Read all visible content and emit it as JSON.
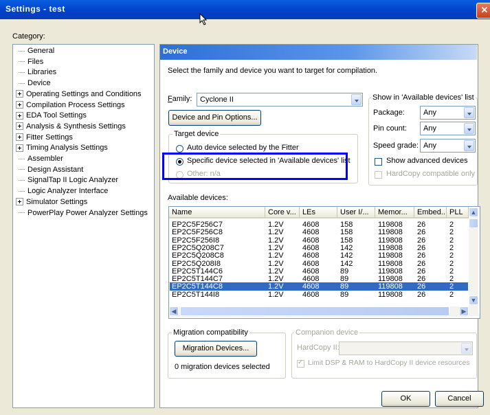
{
  "window": {
    "title": "Settings - test",
    "close_glyph": "✕"
  },
  "category": {
    "label": "Category:",
    "items": [
      {
        "label": "General",
        "expandable": false
      },
      {
        "label": "Files",
        "expandable": false
      },
      {
        "label": "Libraries",
        "expandable": false
      },
      {
        "label": "Device",
        "expandable": false
      },
      {
        "label": "Operating Settings and Conditions",
        "expandable": true
      },
      {
        "label": "Compilation Process Settings",
        "expandable": true
      },
      {
        "label": "EDA Tool Settings",
        "expandable": true
      },
      {
        "label": "Analysis & Synthesis Settings",
        "expandable": true
      },
      {
        "label": "Fitter Settings",
        "expandable": true
      },
      {
        "label": "Timing Analysis Settings",
        "expandable": true
      },
      {
        "label": "Assembler",
        "expandable": false
      },
      {
        "label": "Design Assistant",
        "expandable": false
      },
      {
        "label": "SignalTap II Logic Analyzer",
        "expandable": false
      },
      {
        "label": "Logic Analyzer Interface",
        "expandable": false
      },
      {
        "label": "Simulator Settings",
        "expandable": true
      },
      {
        "label": "PowerPlay Power Analyzer Settings",
        "expandable": false
      }
    ]
  },
  "device": {
    "header": "Device",
    "description": "Select the family and device you want to target for compilation.",
    "family_label": "Family:",
    "family_value": "Cyclone II",
    "device_pin_options_button": "Device and Pin Options...",
    "target_device": {
      "label": "Target device",
      "auto": "Auto device selected by the Fitter",
      "specific": "Specific device selected in 'Available devices' list",
      "other": "Other:  n/a"
    },
    "show_in_list": {
      "label": "Show in 'Available devices' list",
      "package_label": "Package:",
      "package_value": "Any",
      "pin_count_label": "Pin count:",
      "pin_count_value": "Any",
      "speed_grade_label": "Speed grade:",
      "speed_grade_value": "Any",
      "show_advanced": "Show advanced devices",
      "hardcopy_only": "HardCopy compatible only"
    },
    "available_devices_label": "Available devices:",
    "columns": [
      "Name",
      "Core v...",
      "LEs",
      "User I/...",
      "Memor...",
      "Embed...",
      "PLL"
    ],
    "rows": [
      [
        "EP2C5F256C7",
        "1.2V",
        "4608",
        "158",
        "119808",
        "26",
        "2"
      ],
      [
        "EP2C5F256C8",
        "1.2V",
        "4608",
        "158",
        "119808",
        "26",
        "2"
      ],
      [
        "EP2C5F256I8",
        "1.2V",
        "4608",
        "158",
        "119808",
        "26",
        "2"
      ],
      [
        "EP2C5Q208C7",
        "1.2V",
        "4608",
        "142",
        "119808",
        "26",
        "2"
      ],
      [
        "EP2C5Q208C8",
        "1.2V",
        "4608",
        "142",
        "119808",
        "26",
        "2"
      ],
      [
        "EP2C5Q208I8",
        "1.2V",
        "4608",
        "142",
        "119808",
        "26",
        "2"
      ],
      [
        "EP2C5T144C6",
        "1.2V",
        "4608",
        "89",
        "119808",
        "26",
        "2"
      ],
      [
        "EP2C5T144C7",
        "1.2V",
        "4608",
        "89",
        "119808",
        "26",
        "2"
      ],
      [
        "EP2C5T144C8",
        "1.2V",
        "4608",
        "89",
        "119808",
        "26",
        "2"
      ],
      [
        "EP2C5T144I8",
        "1.2V",
        "4608",
        "89",
        "119808",
        "26",
        "2"
      ]
    ],
    "selected_row": 8,
    "migration": {
      "label": "Migration compatibility",
      "button": "Migration Devices...",
      "status": "0 migration devices selected"
    },
    "companion": {
      "label": "Companion device",
      "hardcopy_label": "HardCopy II:",
      "limit_label": "Limit DSP & RAM to HardCopy II device resources"
    },
    "ok_button": "OK",
    "cancel_button": "Cancel"
  },
  "colors": {
    "title_blue": "#0040c8",
    "selection": "#316ac5",
    "highlight_frame": "#0000ff"
  }
}
